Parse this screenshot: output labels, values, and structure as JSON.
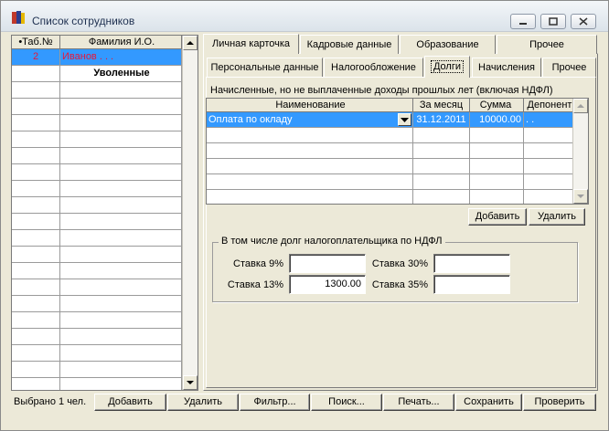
{
  "window": {
    "title": "Список сотрудников"
  },
  "employees": {
    "columns": [
      "•Таб.№",
      "Фамилия И.О."
    ],
    "rows": [
      {
        "tab_no": "2",
        "name": "Иванов . . ."
      },
      {
        "tab_no": "",
        "name": "Уволенные"
      }
    ],
    "empty_rows": 21
  },
  "main_tabs": [
    "Личная карточка",
    "Кадровые данные",
    "Образование",
    "Прочее"
  ],
  "sub_tabs": [
    "Персональные данные",
    "Налогообложение",
    "Долги",
    "Начисления",
    "Прочее"
  ],
  "debts": {
    "caption": "Начисленные, но не выплаченные доходы прошлых лет (включая НДФЛ)",
    "columns": [
      "Наименование",
      "За месяц",
      "Сумма",
      "Депонент"
    ],
    "rows": [
      {
        "name": "Оплата по окладу",
        "month": "31.12.2011",
        "sum": "10000.00",
        "deposit": ". ."
      }
    ],
    "empty_rows": 5,
    "add_label": "Добавить",
    "delete_label": "Удалить"
  },
  "ndfl": {
    "group_title": "В том числе долг налогоплательщика по НДФЛ",
    "rate9_label": "Ставка 9%",
    "rate9_value": "",
    "rate13_label": "Ставка 13%",
    "rate13_value": "1300.00",
    "rate30_label": "Ставка 30%",
    "rate30_value": "",
    "rate35_label": "Ставка 35%",
    "rate35_value": ""
  },
  "footer": {
    "status": "Выбрано 1 чел.",
    "buttons": [
      "Добавить",
      "Удалить",
      "Фильтр...",
      "Поиск...",
      "Печать...",
      "Сохранить",
      "Проверить"
    ]
  }
}
